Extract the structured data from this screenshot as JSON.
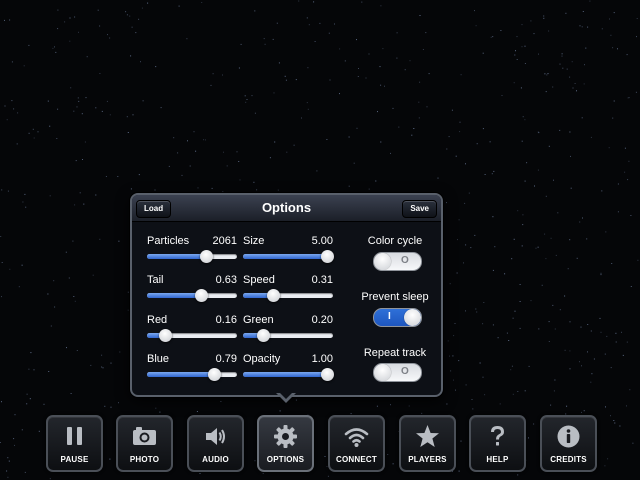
{
  "popover": {
    "title": "Options",
    "load_label": "Load",
    "save_label": "Save"
  },
  "sliders": [
    {
      "label": "Particles",
      "value": "2061",
      "fraction": 0.65
    },
    {
      "label": "Size",
      "value": "5.00",
      "fraction": 0.93
    },
    {
      "label": "Tail",
      "value": "0.63",
      "fraction": 0.6
    },
    {
      "label": "Speed",
      "value": "0.31",
      "fraction": 0.33
    },
    {
      "label": "Red",
      "value": "0.16",
      "fraction": 0.2
    },
    {
      "label": "Green",
      "value": "0.20",
      "fraction": 0.22
    },
    {
      "label": "Blue",
      "value": "0.79",
      "fraction": 0.74
    },
    {
      "label": "Opacity",
      "value": "1.00",
      "fraction": 0.93
    }
  ],
  "toggles": [
    {
      "label": "Color cycle",
      "state": "off",
      "symbol": "O"
    },
    {
      "label": "Prevent sleep",
      "state": "on",
      "symbol": "I"
    },
    {
      "label": "Repeat track",
      "state": "off",
      "symbol": "O"
    }
  ],
  "toolbar": [
    {
      "label": "PAUSE",
      "icon": "pause-icon"
    },
    {
      "label": "PHOTO",
      "icon": "camera-icon"
    },
    {
      "label": "AUDIO",
      "icon": "speaker-icon"
    },
    {
      "label": "OPTIONS",
      "icon": "gear-icon",
      "active": true
    },
    {
      "label": "CONNECT",
      "icon": "wifi-icon"
    },
    {
      "label": "PLAYERS",
      "icon": "star-icon"
    },
    {
      "label": "HELP",
      "icon": "question-icon"
    },
    {
      "label": "CREDITS",
      "icon": "info-icon"
    }
  ],
  "colors": {
    "background": "#050608",
    "accent_blue": "#2f65cf",
    "icon_gray": "#b9bdc3"
  }
}
